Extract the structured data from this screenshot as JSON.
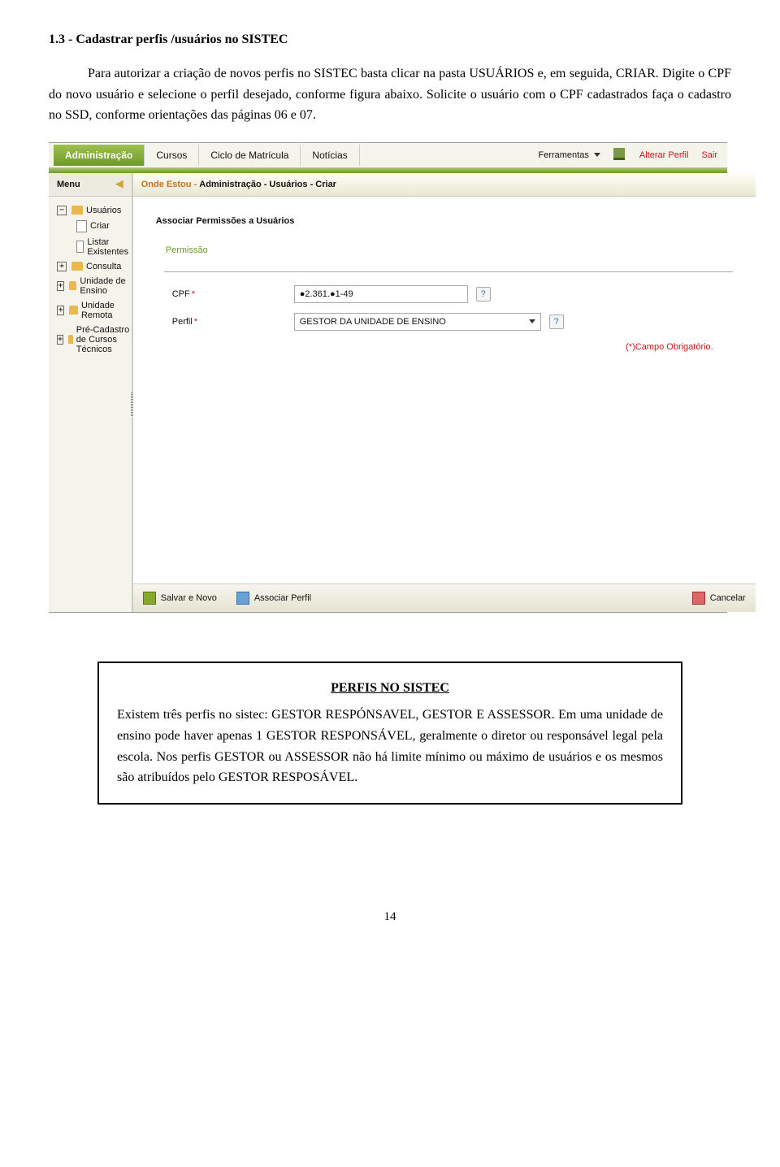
{
  "section_title": "1.3 - Cadastrar perfis /usuários no SISTEC",
  "para1": "Para autorizar a criação de novos perfis no SISTEC basta clicar na pasta USUÁRIOS e, em seguida, CRIAR. Digite o CPF do novo usuário e selecione o perfil desejado, conforme figura abaixo. Solicite o usuário com o CPF cadastrados faça o cadastro no SSD, conforme orientações das páginas 06 e 07.",
  "topbar": {
    "tabs": [
      "Administração",
      "Cursos",
      "Ciclo de Matrícula",
      "Notícias"
    ],
    "right": {
      "ferramentas": "Ferramentas",
      "alterar": "Alterar Perfil",
      "sair": "Sair"
    }
  },
  "sidebar": {
    "title": "Menu",
    "nodes": {
      "usuarios": "Usuários",
      "criar": "Criar",
      "listar": "Listar Existentes",
      "consulta": "Consulta",
      "unidade_ensino": "Unidade de Ensino",
      "unidade_remota": "Unidade Remota",
      "precad": "Pré-Cadastro de Cursos Técnicos"
    }
  },
  "breadcrumb": {
    "left": "Onde Estou -",
    "path": "Administração - Usuários - Criar"
  },
  "form": {
    "title": "Associar Permissões a Usuários",
    "legend": "Permissão",
    "cpf_label": "CPF",
    "cpf_value": "●2.361.●1-49",
    "perfil_label": "Perfil",
    "perfil_value": "GESTOR DA UNIDADE DE ENSINO",
    "help": "?",
    "campo": "(*)Campo Obrigatório."
  },
  "bottombar": {
    "salvar": "Salvar e Novo",
    "associar": "Associar Perfil",
    "cancelar": "Cancelar"
  },
  "box": {
    "title": "PERFIS NO SISTEC",
    "body": "Existem três perfis no sistec: GESTOR RESPÓNSAVEL, GESTOR E ASSESSOR. Em uma unidade de ensino pode haver apenas 1 GESTOR RESPONSÁVEL, geralmente o diretor ou responsável legal pela escola. Nos  perfis GESTOR ou ASSESSOR não há limite mínimo ou máximo de usuários e os mesmos são atribuídos pelo GESTOR RESPOSÁVEL."
  },
  "page_number": "14"
}
